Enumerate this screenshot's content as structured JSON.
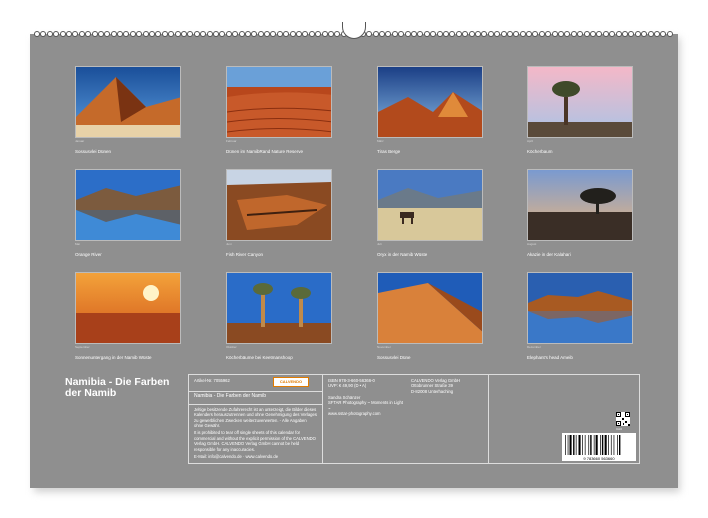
{
  "tiles": [
    {
      "tiny": "Januar",
      "caption": "Sossusvlei Dünen"
    },
    {
      "tiny": "Februar",
      "caption": "Dünen im NamibRand Nature Reserve"
    },
    {
      "tiny": "März",
      "caption": "Tiras Berge"
    },
    {
      "tiny": "April",
      "caption": "Köcherbaum"
    },
    {
      "tiny": "Mai",
      "caption": "Orange River"
    },
    {
      "tiny": "Juni",
      "caption": "Fish River Canyon"
    },
    {
      "tiny": "Juli",
      "caption": "Oryx in der Namib Wüste"
    },
    {
      "tiny": "August",
      "caption": "Akazie in der Kalahari"
    },
    {
      "tiny": "September",
      "caption": "Sonnenuntergang in der Namib Wüste"
    },
    {
      "tiny": "Oktober",
      "caption": "Köcherbäume bei Keetmanshoop"
    },
    {
      "tiny": "November",
      "caption": "Sossusvlei Düne"
    },
    {
      "tiny": "Dezember",
      "caption": "Elephant's head Ameib"
    }
  ],
  "title_line1": "Namibia - Die Farben",
  "title_line2": "der Namib",
  "info": {
    "article": "Artikel-Nr. 7055962",
    "logo": "CALVENDO",
    "product_title": "Namibia - Die Farben der Namib",
    "desc_de": "Jeltige besitzende Zufahrerecht ist an unterzeigt, die Bilder dieses Kalenders herauszutrennen und ohne Genehmigung des Verlages zu gewerblichen Zwecken weiterzuverwerten. - Alle Angaben ohne Gewähr.",
    "desc_en": "It is prohibited to tear off single sheets of this calendar for commercial and without the explicit permission of the CALVENDO Verlag GmbH. CALVENDO Verlag GmbH cannot be held responsible for any inaccuracies.",
    "email": "E-Mail: info@calvendo.de · www.calvendo.de",
    "isbn": "ISBN 978-3-660-56366-0",
    "price": "UVP: € 49,90 (D • A)",
    "author": "Sandra Schänzer",
    "photo_credit": "SFTAR Photography ~ Moments in Light ~",
    "website": "www.sstar-photography.com",
    "publisher1": "CALVENDO Verlag GmbH",
    "publisher2": "Ottobrunner Straße 39",
    "publisher3": "D-82008 Unterhaching",
    "qr_label": "CA3",
    "barcode_digits": "9 783660 563660"
  }
}
